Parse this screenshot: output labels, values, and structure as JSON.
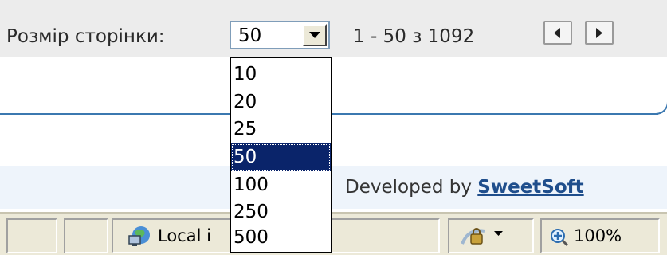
{
  "pager": {
    "page_size_label": "Розмір сторінки:",
    "selected_page_size": "50",
    "range_text": "1 - 50 з 1092",
    "page_size_options": [
      "10",
      "20",
      "25",
      "50",
      "100",
      "250",
      "500"
    ]
  },
  "footer": {
    "developed_by_prefix": "Developed by",
    "developer_link": "SweetSoft"
  },
  "status_bar": {
    "zone_label": "Local i",
    "zoom_label": "100%"
  },
  "colors": {
    "selection": "#0a246a",
    "toolbar_bg": "#ececec",
    "link": "#1f4e8c",
    "rule": "#3b78b0"
  }
}
